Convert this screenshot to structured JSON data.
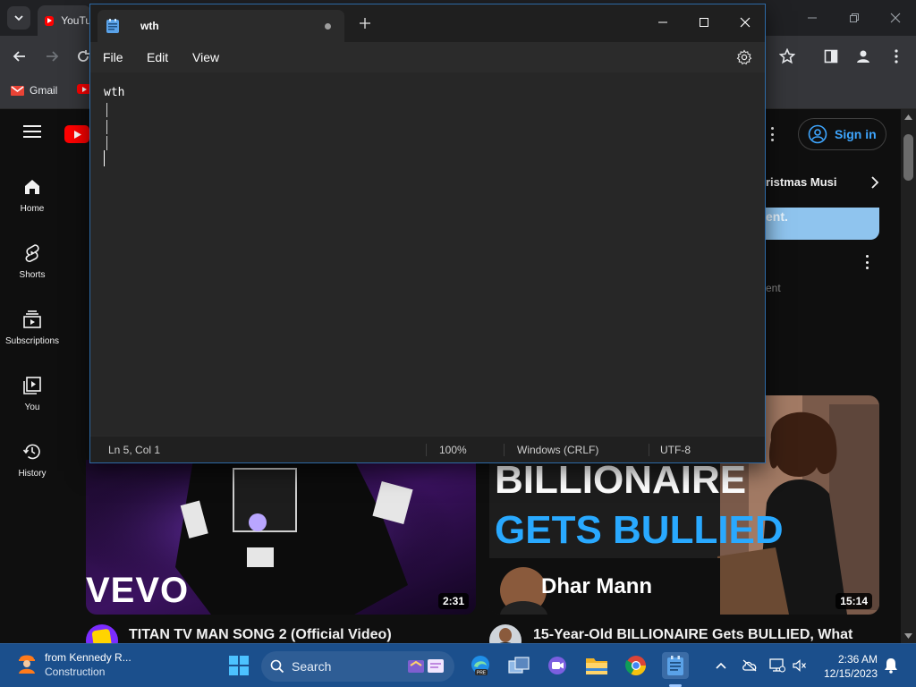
{
  "chrome": {
    "tab_title": "YouTu",
    "bookmark_gmail": "Gmail"
  },
  "youtube": {
    "sidebar": [
      {
        "label": "Home",
        "icon": "home-icon"
      },
      {
        "label": "Shorts",
        "icon": "shorts-icon"
      },
      {
        "label": "Subscriptions",
        "icon": "subscriptions-icon"
      },
      {
        "label": "You",
        "icon": "you-icon"
      },
      {
        "label": "History",
        "icon": "history-icon"
      }
    ],
    "sign_in_label": "Sign in",
    "chip_text": "ristmas Musi",
    "banner_text": "ent.",
    "ghost_text": "ent",
    "videos": [
      {
        "title": "TITAN TV MAN SONG 2 (Official Video)",
        "duration": "2:31",
        "thumb_text": "VEVO"
      },
      {
        "title": "15-Year-Old BILLIONAIRE Gets BULLIED, What",
        "duration": "15:14",
        "thumb_line1": "BILLIONAIRE",
        "thumb_line2": "GETS BULLIED",
        "thumb_brand": "Dhar Mann"
      }
    ]
  },
  "notepad": {
    "tab_title": "wth",
    "menu": [
      "File",
      "Edit",
      "View"
    ],
    "content": "wth",
    "status": {
      "position": "Ln 5, Col 1",
      "zoom": "100%",
      "line_ending": "Windows (CRLF)",
      "encoding": "UTF-8"
    }
  },
  "taskbar": {
    "weather_title": "from Kennedy R...",
    "weather_subtitle": "Construction",
    "search_label": "Search",
    "time": "2:36 AM",
    "date": "12/15/2023"
  },
  "colors": {
    "notepad_border": "#2d6aa6",
    "taskbar": "#1b4f8c",
    "youtube_red": "#ff0000",
    "sign_in_blue": "#3ea6ff"
  }
}
